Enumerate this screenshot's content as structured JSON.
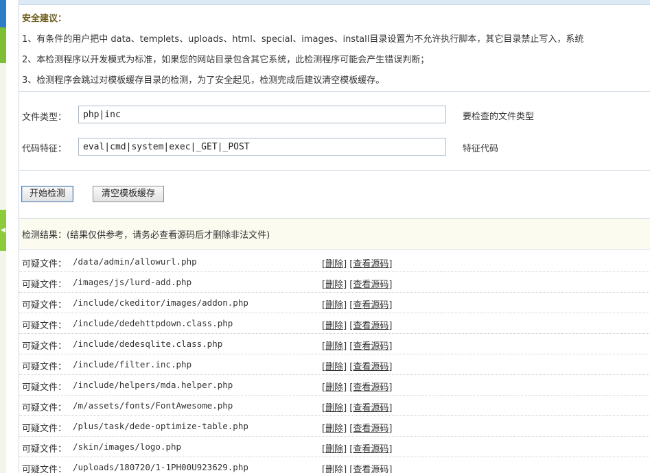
{
  "advice": {
    "title": "安全建议：",
    "lines": [
      "1、有条件的用户把中 data、templets、uploads、html、special、images、install目录设置为不允许执行脚本，其它目录禁止写入，系统",
      "2、本检测程序以开发模式为标准，如果您的网站目录包含其它系统，此检测程序可能会产生错误判断；",
      "3、检测程序会跳过对模板缓存目录的检测，为了安全起见，检测完成后建议清空模板缓存。"
    ]
  },
  "form": {
    "filetype_label": "文件类型：",
    "filetype_value": "php|inc",
    "filetype_hint": "要检查的文件类型",
    "code_label": "代码特征：",
    "code_value": "eval|cmd|system|exec|_GET|_POST",
    "code_hint": "特征代码"
  },
  "buttons": {
    "start": "开始检测",
    "clear_cache": "清空模板缓存"
  },
  "result": {
    "header": "检测结果：(结果仅供参考，请务必查看源码后才删除非法文件)",
    "prefix": "可疑文件：",
    "delete_label": "删除",
    "view_label": "查看源码",
    "files": [
      "/data/admin/allowurl.php",
      "/images/js/lurd-add.php",
      "/include/ckeditor/images/addon.php",
      "/include/dedehttpdown.class.php",
      "/include/dedesqlite.class.php",
      "/include/filter.inc.php",
      "/include/helpers/mda.helper.php",
      "/m/assets/fonts/FontAwesome.php",
      "/plus/task/dede-optimize-table.php",
      "/skin/images/logo.php",
      "/uploads/180720/1-1PH00U923629.php"
    ]
  },
  "colors": {
    "accent_blue": "#2e7bc6",
    "accent_green": "#7cbf35",
    "advice_title": "#6b5b1a"
  }
}
